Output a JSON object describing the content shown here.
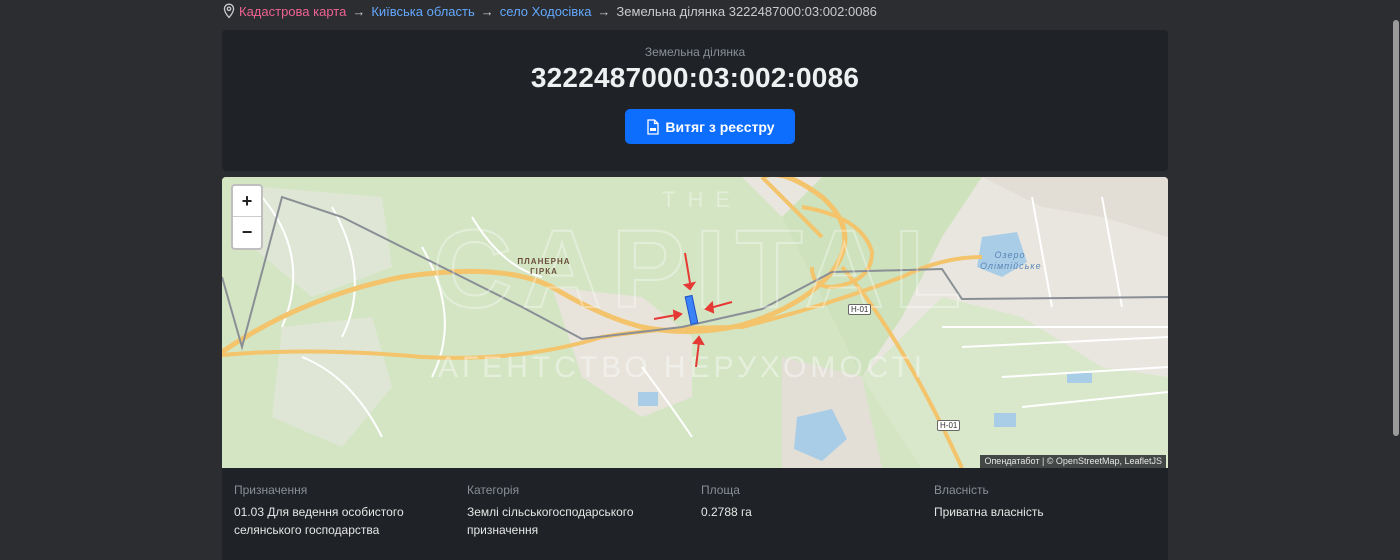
{
  "breadcrumb": {
    "items": [
      {
        "label": "Кадастрова карта"
      },
      {
        "label": "Київська область"
      },
      {
        "label": "село Ходосівка"
      },
      {
        "label": "Земельна ділянка 3222487000:03:002:0086"
      }
    ],
    "separator": "→"
  },
  "parcel": {
    "subtitle": "Земельна ділянка",
    "number": "3222487000:03:002:0086",
    "extract_button": "Витяг з реєстру"
  },
  "map": {
    "zoom_in": "+",
    "zoom_out": "−",
    "place_label": "ПЛАНЕРНА\nГІРКА",
    "lake_label": "Озеро\nОлімпійське",
    "road_shield_1": "Н-01",
    "road_shield_2": "Н-01",
    "watermark_line1": "THE",
    "watermark_line2": "CAPITAL",
    "watermark_line3": "АГЕНТСТВО НЕРУХОМОСТІ",
    "attribution": "Опендатабот | © OpenStreetMap, LeafletJS"
  },
  "details": {
    "purpose": {
      "label": "Призначення",
      "value": "01.03 Для ведення особистого селянського господарства"
    },
    "category": {
      "label": "Категорія",
      "value": "Землі сільськогосподарського призначення"
    },
    "area": {
      "label": "Площа",
      "value": "0.2788 га"
    },
    "ownership": {
      "label": "Власність",
      "value": "Приватна власність"
    }
  },
  "colors": {
    "background": "#2b2d30",
    "card": "#1f2226",
    "primary_button": "#0d6efd",
    "breadcrumb_root": "#f06292",
    "breadcrumb_link": "#64a8ff",
    "parcel_highlight": "#3b82f6",
    "marker_arrows": "#e53935"
  },
  "icons": {
    "location": "map-pin-icon",
    "document": "pdf-document-icon"
  }
}
